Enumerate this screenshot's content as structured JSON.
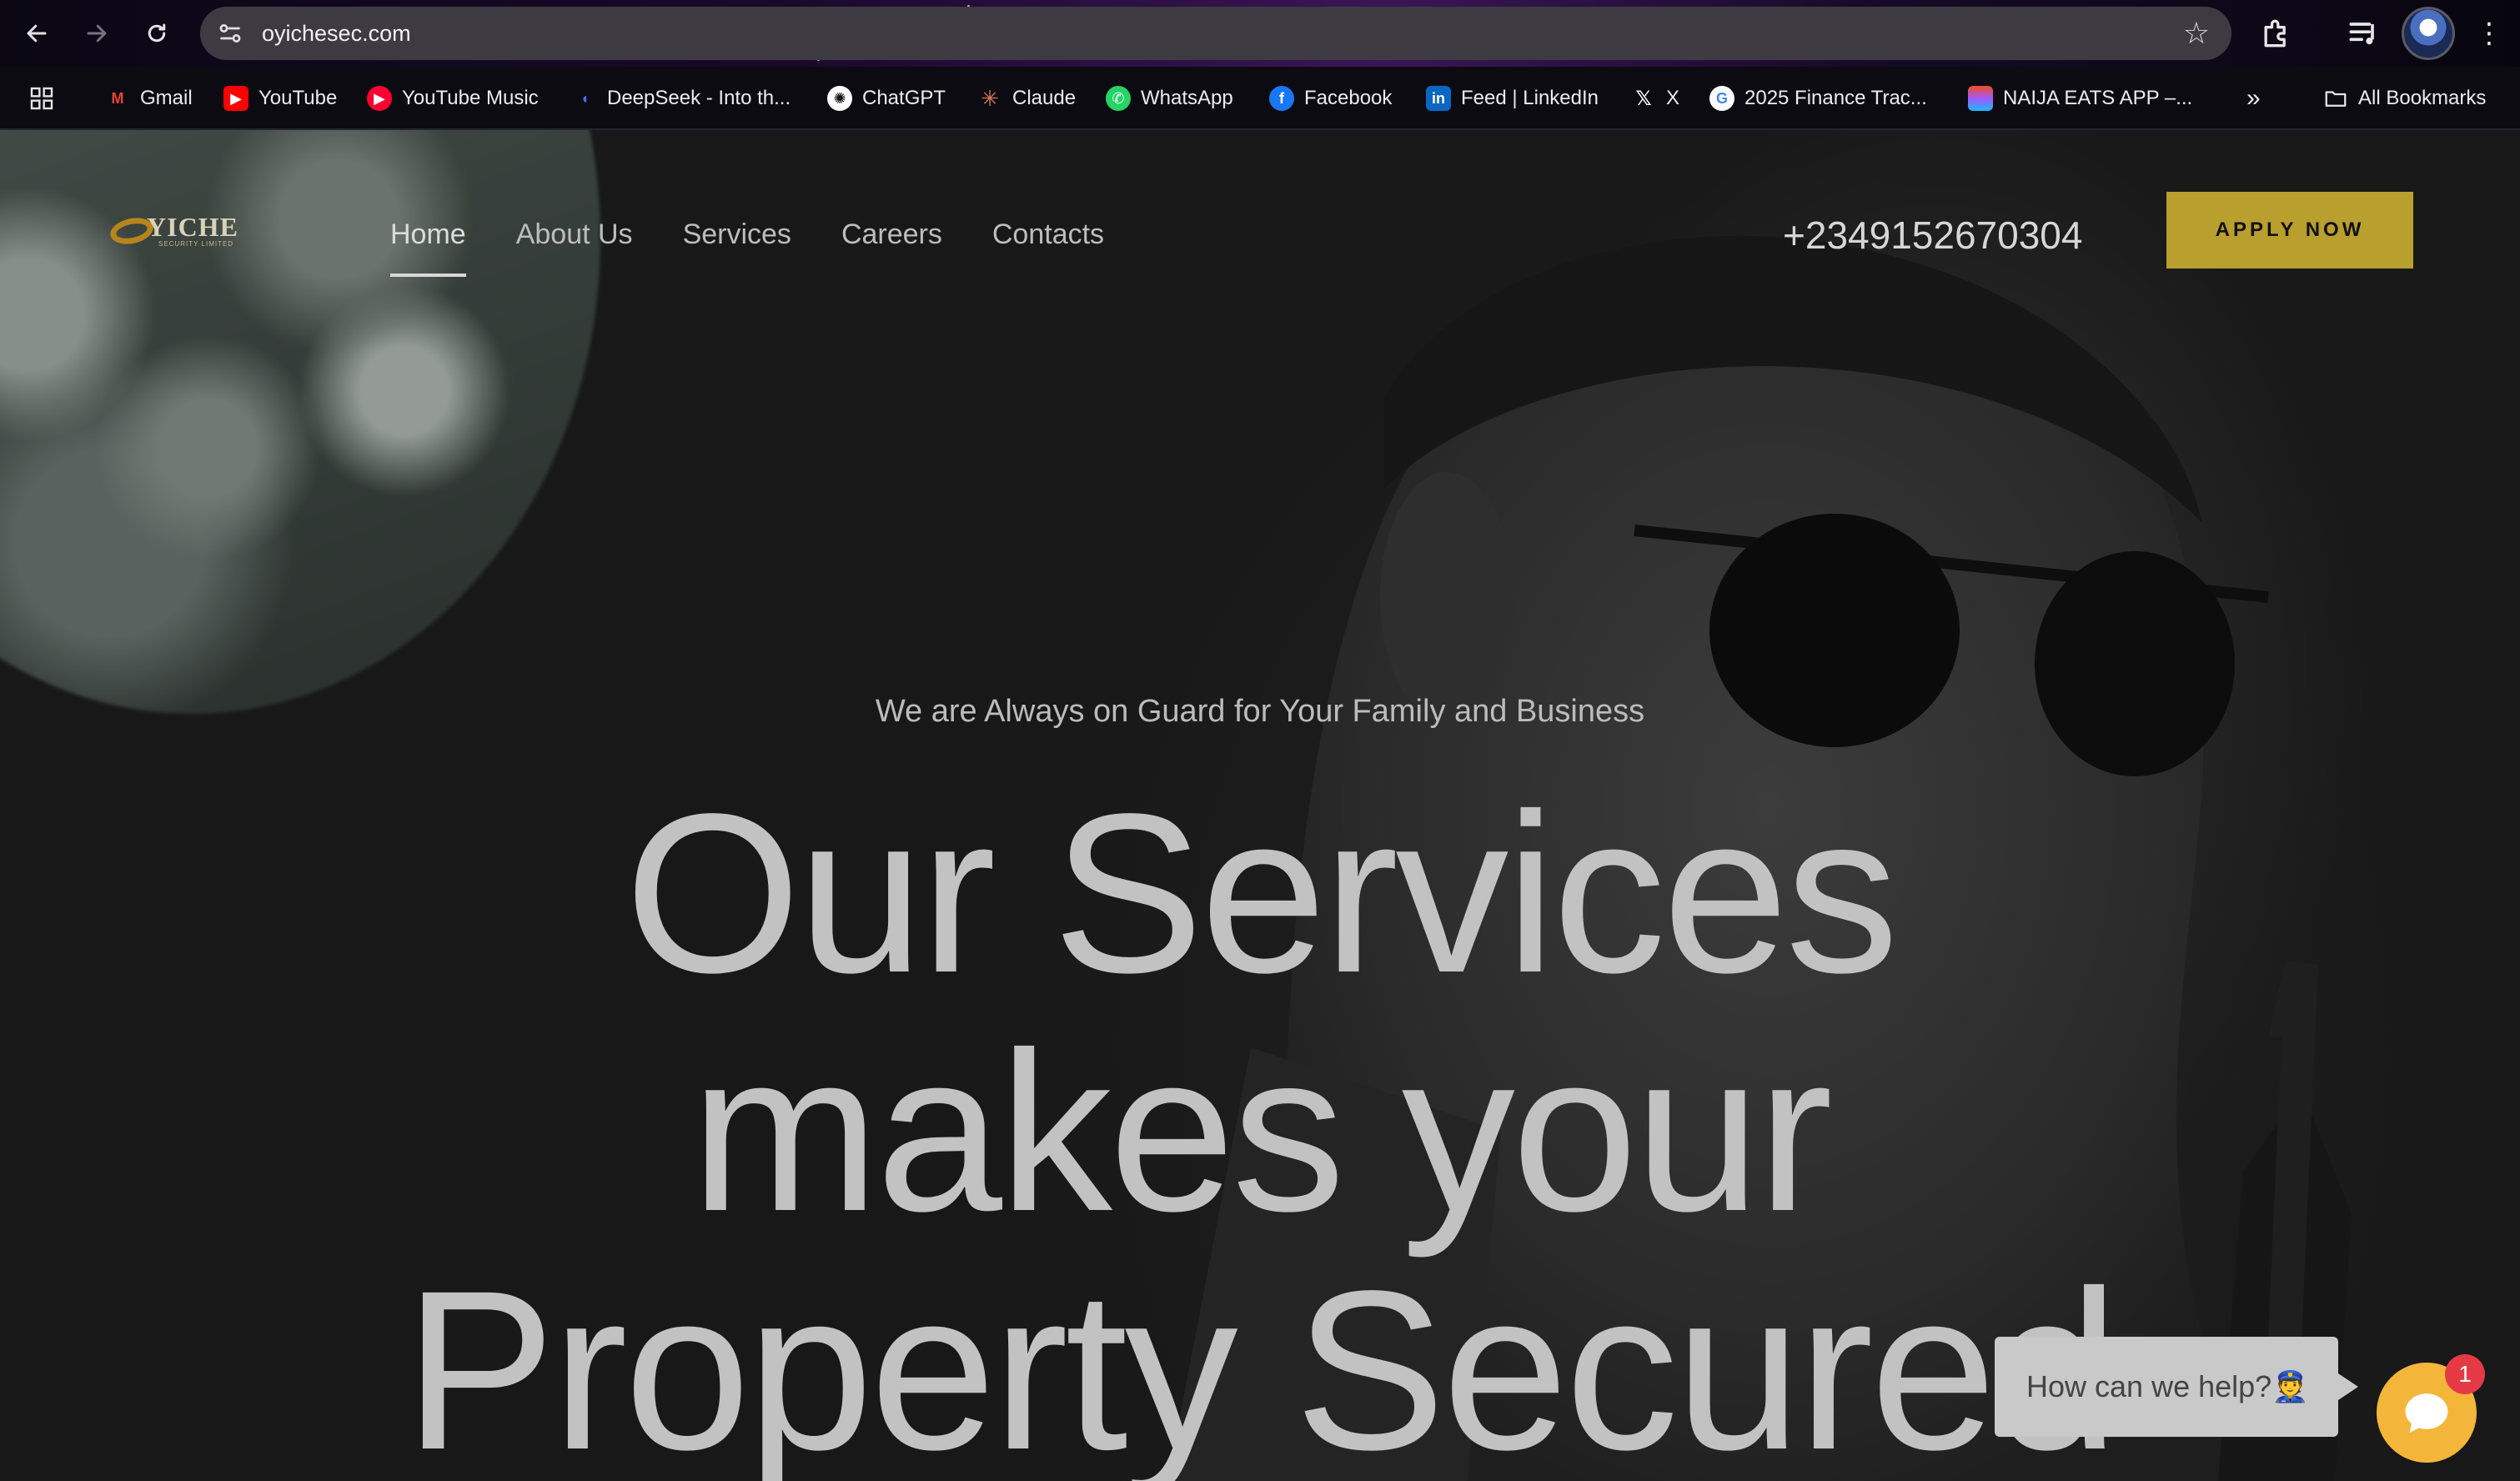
{
  "browser": {
    "url": "oyichesec.com",
    "bookmarks": [
      {
        "label": "Gmail",
        "icon": "gmail-icon",
        "color": "#ea4335"
      },
      {
        "label": "YouTube",
        "icon": "youtube-icon",
        "color": "#ff0000"
      },
      {
        "label": "YouTube Music",
        "icon": "youtube-music-icon",
        "color": "#ff0033"
      },
      {
        "label": "DeepSeek - Into th...",
        "icon": "deepseek-icon",
        "color": "#4d6bfe"
      },
      {
        "label": "ChatGPT",
        "icon": "chatgpt-icon",
        "color": "#ffffff"
      },
      {
        "label": "Claude",
        "icon": "claude-icon",
        "color": "#d97757"
      },
      {
        "label": "WhatsApp",
        "icon": "whatsapp-icon",
        "color": "#25d366"
      },
      {
        "label": "Facebook",
        "icon": "facebook-icon",
        "color": "#1877f2"
      },
      {
        "label": "Feed | LinkedIn",
        "icon": "linkedin-icon",
        "color": "#0a66c2"
      },
      {
        "label": "X",
        "icon": "x-icon",
        "color": "#ffffff"
      },
      {
        "label": "2025 Finance Trac...",
        "icon": "google-icon",
        "color": "#4285f4"
      },
      {
        "label": "NAIJA EATS APP –...",
        "icon": "figma-icon",
        "color": "#f24e1e"
      }
    ],
    "all_bookmarks_label": "All Bookmarks"
  },
  "site": {
    "logo_text": "YICHE",
    "logo_subtext": "SECURITY LIMITED",
    "nav": [
      {
        "label": "Home",
        "active": true
      },
      {
        "label": "About Us",
        "active": false
      },
      {
        "label": "Services",
        "active": false
      },
      {
        "label": "Careers",
        "active": false
      },
      {
        "label": "Contacts",
        "active": false
      }
    ],
    "phone": "+2349152670304",
    "apply_label": "APPLY NOW",
    "tagline": "We are Always on Guard for Your Family and Business",
    "headline": [
      "Our Services",
      "makes your",
      "Property Secured"
    ],
    "accent_color": "#b89f2e"
  },
  "chat": {
    "prompt": "How can we help?👮",
    "badge_count": "1",
    "launcher_color": "#f3b63a"
  }
}
